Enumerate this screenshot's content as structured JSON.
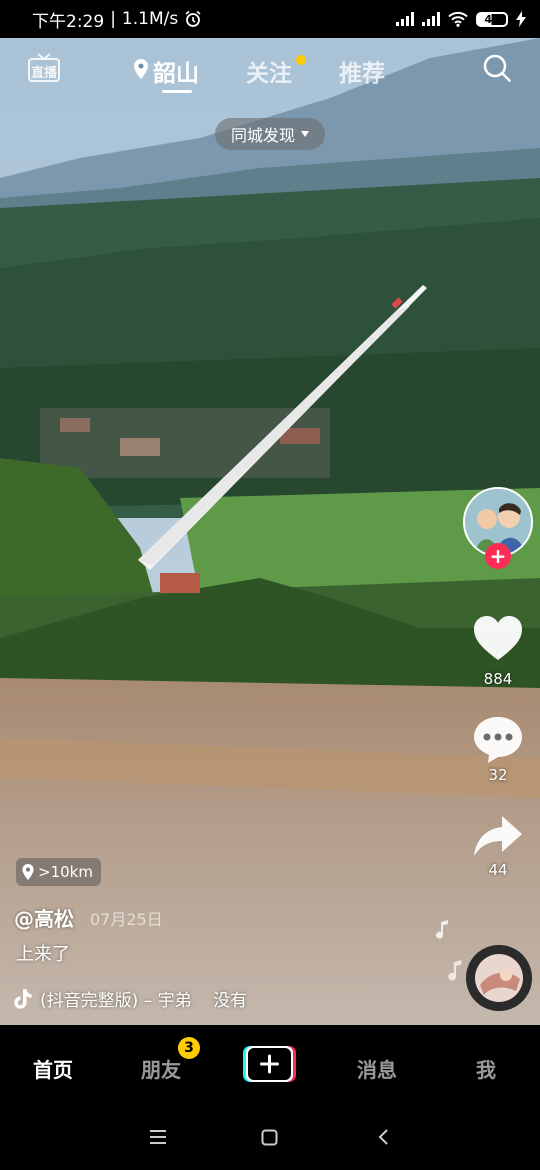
{
  "status_bar": {
    "time": "下午2:29",
    "speed": "1.1M/s",
    "battery": "48"
  },
  "top_nav": {
    "live_label": "直播",
    "tabs": [
      {
        "label": "韶山"
      },
      {
        "label": "关注"
      },
      {
        "label": "推荐"
      }
    ]
  },
  "city_pill": {
    "label": "同城发现"
  },
  "side_actions": {
    "likes": "884",
    "comments": "32",
    "shares": "44"
  },
  "video_info": {
    "distance": ">10km",
    "author": "@高松",
    "date": "07月25日",
    "description": "上来了",
    "music": "(抖音完整版) – 宇弟    没有"
  },
  "bottom_tabs": {
    "home": "首页",
    "friends": "朋友",
    "friends_badge": "3",
    "messages": "消息",
    "me": "我"
  }
}
